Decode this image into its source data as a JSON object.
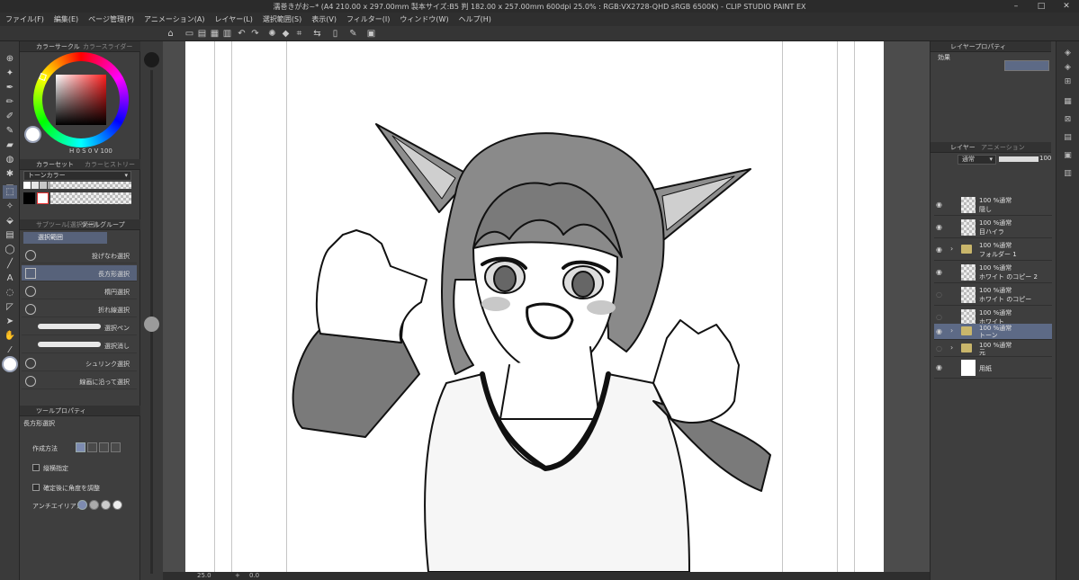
{
  "window": {
    "title": "濡巻きがお~* (A4 210.00 x 297.00mm 製本サイズ:B5 判 182.00 x 257.00mm 600dpi 25.0% : RGB:VX2728-QHD sRGB 6500K) - CLIP STUDIO PAINT EX",
    "minimize": "–",
    "maximize": "□",
    "close": "✕"
  },
  "menu": [
    "ファイル(F)",
    "編集(E)",
    "ページ管理(P)",
    "アニメーション(A)",
    "レイヤー(L)",
    "選択範囲(S)",
    "表示(V)",
    "フィルター(I)",
    "ウィンドウ(W)",
    "ヘルプ(H)"
  ],
  "color_panel": {
    "tab_active": "カラーサークル",
    "tab_inactive": "カラースライダー",
    "hsv_label": "H 0 S 0 V 100",
    "main_color": "#ffffff",
    "selected_hue_color": "#ff1e1e"
  },
  "color_set": {
    "tab_active": "カラーセット",
    "tab_inactive": "カラーヒストリー",
    "set_name": "トーンカラー",
    "swatches": [
      "#ffffff",
      "#e6e6e6",
      "#c8c8c8",
      "#aaaaaa",
      "#8c8c8c",
      "#6e6e6e",
      "#000000",
      "#ffffff"
    ]
  },
  "sub_tool": {
    "tab_active": "サブツール[選択範囲]",
    "tab_inactive": "ツールグループ",
    "group_label": "選択範囲",
    "items": [
      {
        "label": "投げなわ選択"
      },
      {
        "label": "長方形選択",
        "selected": true
      },
      {
        "label": "楕円選択"
      },
      {
        "label": "折れ線選択"
      },
      {
        "label": "選択ペン"
      },
      {
        "label": "選択消し"
      },
      {
        "label": "シュリンク選択"
      },
      {
        "label": "線画に沿って選択"
      }
    ]
  },
  "tool_property": {
    "tab": "ツールプロパティ",
    "title": "長方形選択",
    "mode_label": "作成方法",
    "aspect_label": "縦横指定",
    "angle_label": "確定後に角度を調整",
    "antialias_label": "アンチエイリアス"
  },
  "layer_property": {
    "tab": "レイヤープロパティ",
    "effect_label": "効果"
  },
  "layer_panel": {
    "tab_active": "レイヤー",
    "tab_inactive": "アニメーション",
    "blend_mode": "通常",
    "opacity": "100",
    "layers": [
      {
        "mode": "100 %通常",
        "name": "隠し",
        "visible": true,
        "type": "raster"
      },
      {
        "mode": "100 %通常",
        "name": "目ハイラ",
        "visible": true,
        "type": "raster"
      },
      {
        "mode": "100 %通常",
        "name": "フォルダー 1",
        "visible": true,
        "type": "folder"
      },
      {
        "mode": "100 %通常",
        "name": "ホワイト のコピー 2",
        "visible": true,
        "type": "raster"
      },
      {
        "mode": "100 %通常",
        "name": "ホワイト のコピー",
        "visible": false,
        "type": "raster"
      },
      {
        "mode": "100 %通常",
        "name": "ホワイト",
        "visible": false,
        "type": "raster"
      },
      {
        "mode": "100 %通常",
        "name": "トーン",
        "visible": true,
        "type": "folder",
        "selected": true
      },
      {
        "mode": "100 %通常",
        "name": "元",
        "visible": false,
        "type": "folder"
      },
      {
        "mode": "",
        "name": "用紙",
        "visible": true,
        "type": "paper"
      }
    ]
  },
  "status": {
    "zoom": "25.0",
    "rotation": "0.0"
  },
  "accent_color": "#57627a"
}
